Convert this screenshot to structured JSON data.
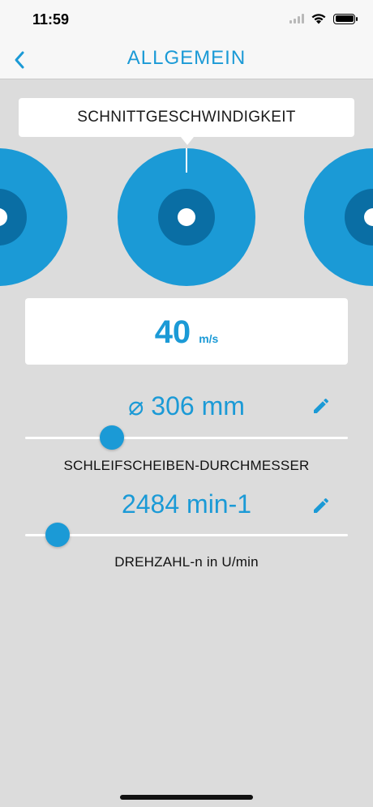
{
  "status": {
    "time": "11:59"
  },
  "nav": {
    "title": "ALLGEMEIN"
  },
  "tooltip": {
    "label": "SCHNITTGESCHWINDIGKEIT"
  },
  "speed": {
    "value": "40",
    "unit": "m/s"
  },
  "diameter": {
    "value": "⌀ 306 mm",
    "label": "SCHLEIFSCHEIBEN-DURCHMESSER",
    "slider_fraction": 0.27
  },
  "rpm": {
    "value": "2484 min-1",
    "label": "DREHZAHL-n in U/min",
    "slider_fraction": 0.1
  },
  "colors": {
    "accent": "#1b9ad6",
    "accent_dark": "#0a6ea4",
    "background": "#dcdcdc"
  },
  "icons": {
    "back": "chevron-left-icon",
    "edit": "pencil-icon",
    "wifi": "wifi-icon",
    "battery": "battery-icon"
  }
}
